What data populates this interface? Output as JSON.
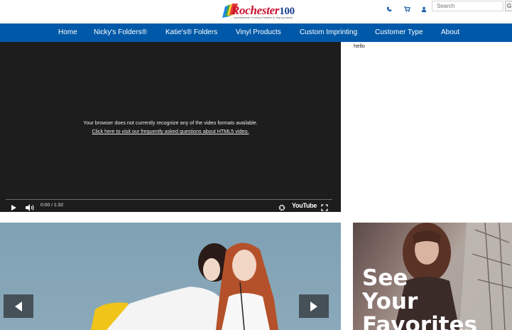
{
  "header": {
    "logo": {
      "name": "Rochester",
      "number": "100",
      "tagline": "manufacturer of school folders & vinyl products"
    },
    "icons": [
      "phone-icon",
      "cart-icon",
      "user-icon"
    ],
    "search": {
      "placeholder": "Search",
      "button_label": "G"
    }
  },
  "nav": {
    "items": [
      {
        "label": "Home"
      },
      {
        "label": "Nicky's Folders®"
      },
      {
        "label": "Katie's® Folders"
      },
      {
        "label": "Vinyl Products"
      },
      {
        "label": "Custom Imprinting"
      },
      {
        "label": "Customer Type"
      },
      {
        "label": "About"
      }
    ]
  },
  "video": {
    "message": "Your browser does not currently recognize any of the video formats available.",
    "link": "Click here to visit our frequently asked questions about HTML5 video.",
    "time": "0:00 / 1:32",
    "brand": "YouTube"
  },
  "sidebar": {
    "text": "hello"
  },
  "promo": {
    "lines": [
      "See",
      "Your",
      "Favorites"
    ]
  },
  "colors": {
    "nav_bg": "#0059a8",
    "video_bg": "#1b1b1b",
    "logo_red": "#c8102e",
    "logo_blue": "#1c3f8f"
  }
}
